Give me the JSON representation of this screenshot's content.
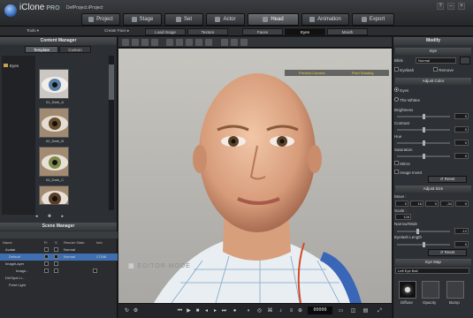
{
  "app": {
    "brand": "iClone",
    "edition": "PRO",
    "project": "DefProject.iProject"
  },
  "main_tabs": [
    "Project",
    "Stage",
    "Set",
    "Actor",
    "Head",
    "Animation",
    "Export"
  ],
  "active_tab": "Head",
  "subbar": {
    "tools": "Tools ▾",
    "create_face": "Create Face ▸",
    "load_image": "Load Image",
    "texture": "Texture",
    "faces": "Faces",
    "eyes": "Eyes",
    "mouth": "Mouth"
  },
  "content_manager": {
    "title": "Content Manager",
    "tabs": [
      "Template",
      "Custom"
    ],
    "tree_item": "Eyes",
    "thumbnails": [
      "01_Dark_A",
      "02_Dark_B",
      "03_Dark_C"
    ]
  },
  "scene_manager": {
    "title": "Scene Manager",
    "columns": [
      "Name",
      "Fl",
      "S",
      "Render State",
      "Info"
    ],
    "rows": [
      {
        "name": "Avatar",
        "state": "Normal",
        "info": ""
      },
      {
        "name": "Default",
        "state": "Normal",
        "info": "27346"
      },
      {
        "name": "ImageLayer",
        "state": "",
        "info": ""
      },
      {
        "name": "Image...",
        "state": "",
        "info": ""
      },
      {
        "name": "Dir/Spot Li...",
        "state": "",
        "info": ""
      },
      {
        "name": "Point Light",
        "state": "",
        "info": ""
      }
    ]
  },
  "viewport": {
    "preview": "Preview Camera",
    "pixel": "Pixel Shading",
    "editor_mode": "EDITOR MODE"
  },
  "playback": {
    "timecode": "00000"
  },
  "modify": {
    "title": "Modify",
    "section_eye": "Eye",
    "blink_label": "Blink",
    "blink_value": "Normal",
    "eyelash": "Eyelash",
    "remove": "Remove",
    "adjust_color": "Adjust Color",
    "eye_options": [
      "Eyes",
      "The Whites"
    ],
    "brightness": "Brightness",
    "brightness_val": "0",
    "contrast": "Contrast",
    "contrast_val": "0",
    "hue": "Hue",
    "hue_val": "0",
    "saturation": "Saturation",
    "saturation_val": "0",
    "mirror": "Mirror",
    "image_invert": "Image Invert",
    "reset": "Reset",
    "adjust_size": "Adjust Size",
    "move": "Move :",
    "move_vals": [
      "0",
      "16",
      "0",
      "-34",
      "0"
    ],
    "scale": "Scale :",
    "scale_val": "128",
    "narrow_wide": "Narrow/Wide",
    "narrow_wide_val": "-12",
    "eyelash_length": "Eyelash Length",
    "eyelash_length_val": "0",
    "eye_map": "Eye Map",
    "eye_map_value": "Left Eye Ball",
    "map_labels": [
      "Diffuse",
      "Opacity",
      "Bump"
    ]
  },
  "colors": {
    "accent_yellow": "#e6cf4a",
    "panel": "#2c2f33",
    "bg": "#1b1d20"
  }
}
